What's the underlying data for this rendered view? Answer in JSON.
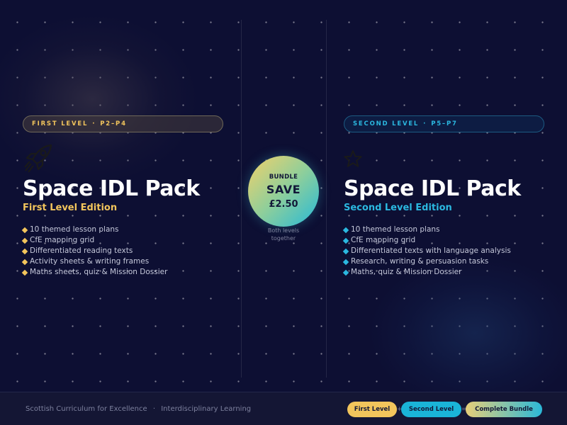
{
  "left_panel": {
    "level_name": "FIRST LEVEL",
    "level_sep": "·",
    "level_range": "P2–P4",
    "icon": "rocket-icon",
    "title": "Space IDL Pack",
    "edition": "First Level Edition",
    "features": [
      "10 themed lesson plans",
      "CfE mapping grid",
      "Differentiated reading texts",
      "Activity sheets & writing frames",
      "Maths sheets, quiz & Mission Dossier"
    ]
  },
  "bundle": {
    "label": "BUNDLE",
    "save": "SAVE",
    "price": "£2.50",
    "note_line1": "Both levels",
    "note_line2": "together"
  },
  "right_panel": {
    "level_name": "SECOND LEVEL",
    "level_sep": "·",
    "level_range": "P5–P7",
    "icon": "star-icon",
    "title": "Space IDL Pack",
    "edition": "Second Level Edition",
    "features": [
      "10 themed lesson plans",
      "CfE mapping grid",
      "Differentiated texts with language analysis",
      "Research, writing & persuasion tasks",
      "Maths, quiz & Mission Dossier"
    ]
  },
  "footer": {
    "curriculum": "Scottish Curriculum for Excellence",
    "sep": "·",
    "subject": "Interdisciplinary Learning",
    "links": {
      "first": "First Level",
      "join1": "+",
      "second": "Second Level",
      "join2": "=",
      "bundle": "Complete Bundle"
    }
  },
  "colors": {
    "background": "#0d0f33",
    "first_level_accent": "#f2c55c",
    "second_level_accent": "#2bb8e0"
  }
}
